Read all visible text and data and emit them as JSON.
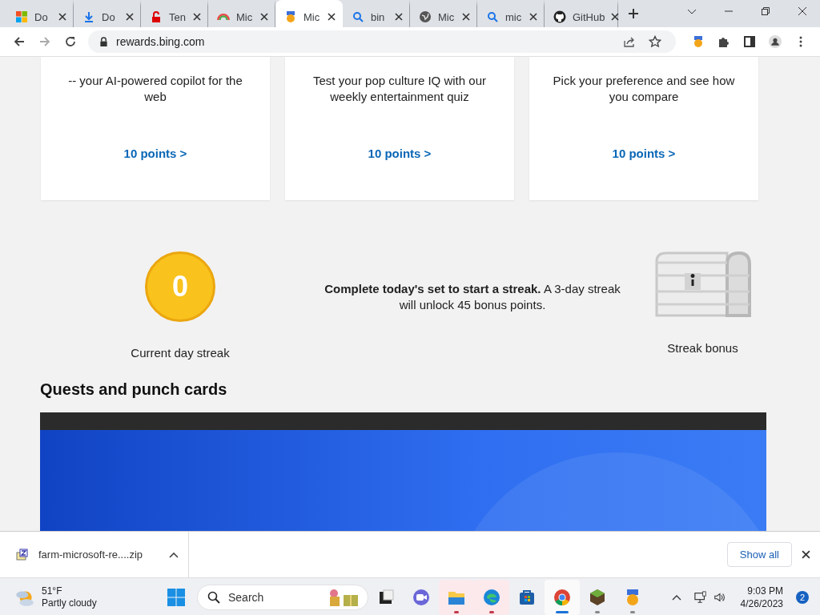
{
  "tabs": [
    {
      "title": "Do",
      "selected": false
    },
    {
      "title": "Do",
      "selected": false
    },
    {
      "title": "Ten",
      "selected": false
    },
    {
      "title": "Mic",
      "selected": false
    },
    {
      "title": "Mic",
      "selected": true
    },
    {
      "title": "bin",
      "selected": false
    },
    {
      "title": "Mic",
      "selected": false
    },
    {
      "title": "mic",
      "selected": false
    },
    {
      "title": "GitHub",
      "selected": false
    }
  ],
  "address": {
    "url": "rewards.bing.com"
  },
  "cards": [
    {
      "description": "-- your AI-powered copilot for the web",
      "points": "10 points >"
    },
    {
      "description": "Test your pop culture IQ with our weekly entertainment quiz",
      "points": "10 points >"
    },
    {
      "description": "Pick your preference and see how you compare",
      "points": "10 points >"
    }
  ],
  "streak": {
    "count": "0",
    "count_label": "Current day streak",
    "message": "**Complete today's set to start a streak.** A 3-day streak will unlock 45 bonus points.",
    "bonus_label": "Streak bonus"
  },
  "section_heading": "Quests and punch cards",
  "download_bar": {
    "file": "farm-microsoft-re....zip",
    "show_all": "Show all"
  },
  "taskbar": {
    "temperature": "51°F",
    "weather": "Partly cloudy",
    "search_placeholder": "Search",
    "apps": [
      {
        "kind": "widgets",
        "running": false,
        "attention": false,
        "selected": false
      },
      {
        "kind": "teams",
        "running": false,
        "attention": false,
        "selected": false
      },
      {
        "kind": "files",
        "running": true,
        "attention": true,
        "selected": false
      },
      {
        "kind": "edge",
        "running": true,
        "attention": true,
        "selected": false
      },
      {
        "kind": "store",
        "running": false,
        "attention": false,
        "selected": false
      },
      {
        "kind": "chrome",
        "running": true,
        "attention": false,
        "selected": true
      },
      {
        "kind": "minecraft",
        "running": true,
        "attention": false,
        "selected": false
      },
      {
        "kind": "rewards",
        "running": true,
        "attention": false,
        "selected": false
      }
    ],
    "time": "9:03 PM",
    "date": "4/26/2023",
    "notifications": "2"
  }
}
